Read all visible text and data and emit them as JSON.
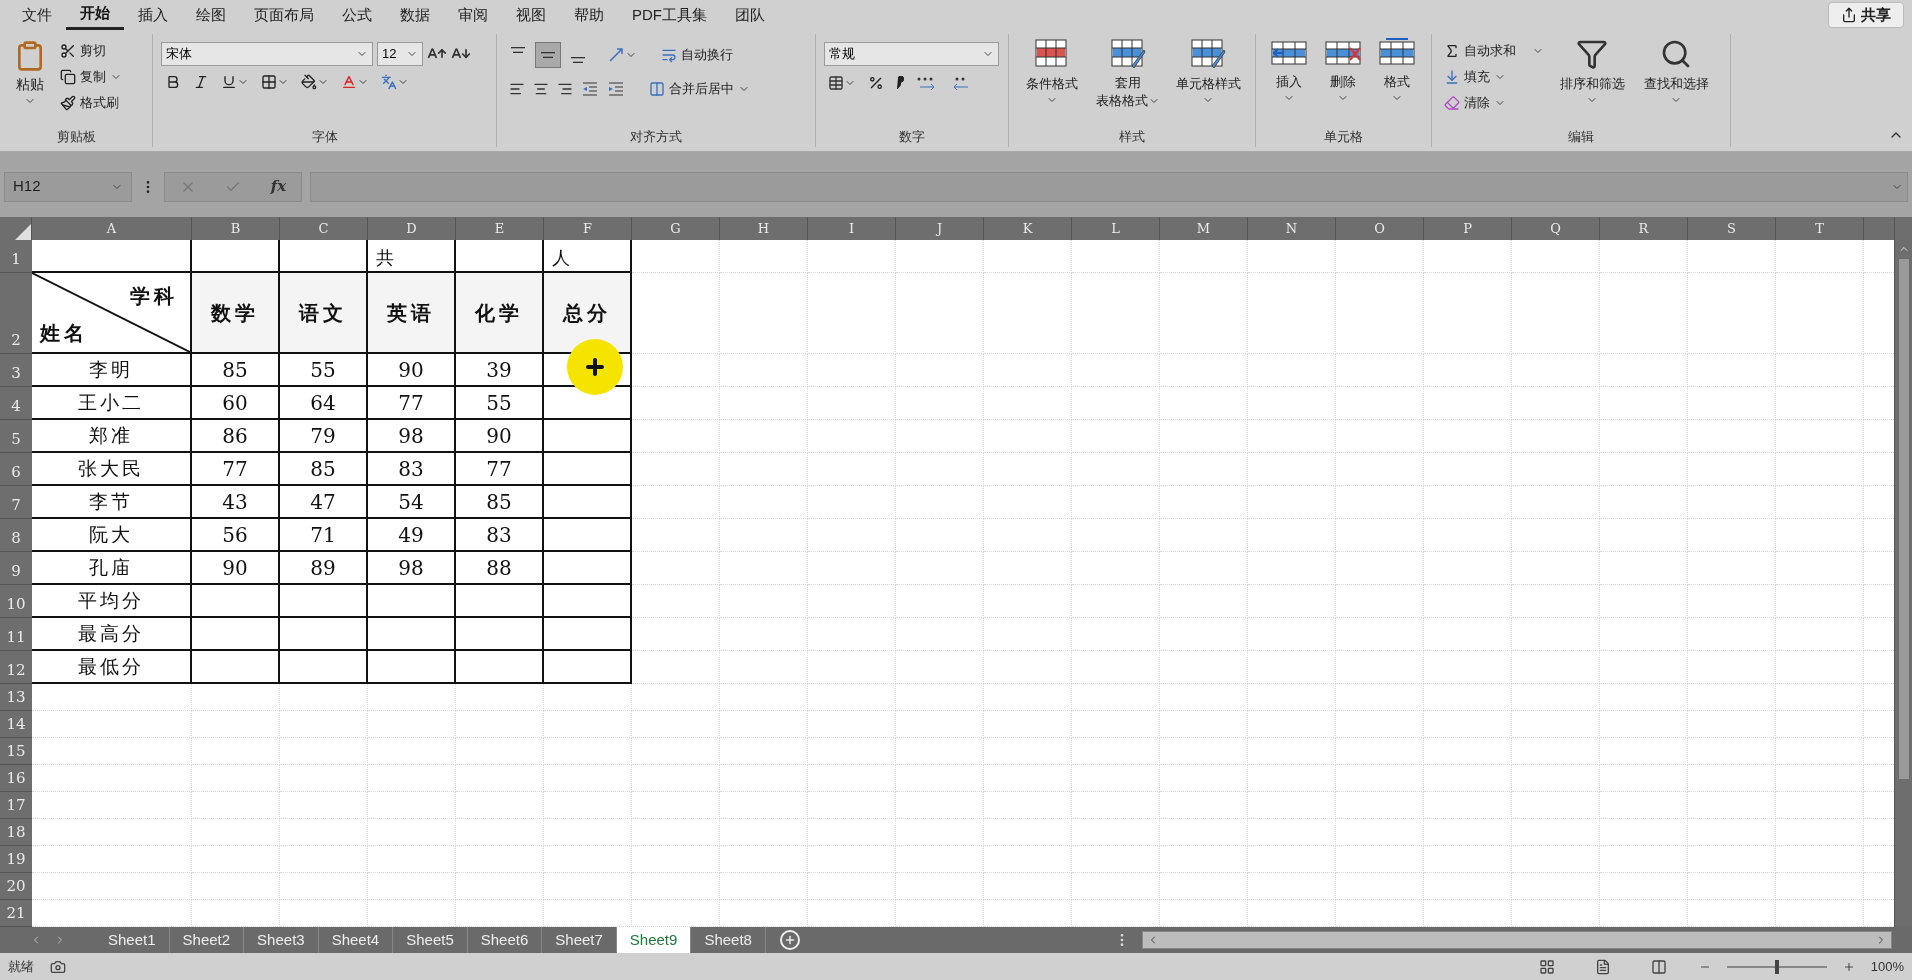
{
  "menu": {
    "tabs": [
      {
        "label": "文件",
        "selected": false
      },
      {
        "label": "开始",
        "selected": true
      },
      {
        "label": "插入",
        "selected": false
      },
      {
        "label": "绘图",
        "selected": false
      },
      {
        "label": "页面布局",
        "selected": false
      },
      {
        "label": "公式",
        "selected": false
      },
      {
        "label": "数据",
        "selected": false
      },
      {
        "label": "审阅",
        "selected": false
      },
      {
        "label": "视图",
        "selected": false
      },
      {
        "label": "帮助",
        "selected": false
      },
      {
        "label": "PDF工具集",
        "selected": false
      },
      {
        "label": "团队",
        "selected": false
      }
    ],
    "share": "共享"
  },
  "ribbon": {
    "clipboard": {
      "paste": "粘贴",
      "cut": "剪切",
      "copy": "复制",
      "format_painter": "格式刷",
      "label": "剪贴板"
    },
    "font": {
      "font_name": "宋体",
      "font_size": "12",
      "label": "字体"
    },
    "alignment": {
      "vertical": [
        {
          "kind": "top",
          "selected": false
        },
        {
          "kind": "middle",
          "selected": true
        },
        {
          "kind": "bottom",
          "selected": false
        }
      ],
      "wrap_text": "自动换行",
      "merge_center": "合并后居中",
      "label": "对齐方式"
    },
    "number": {
      "format": "常规",
      "label": "数字"
    },
    "styles": {
      "conditional": "条件格式",
      "table_format": [
        "套用",
        "表格格式"
      ],
      "cell_styles": "单元格样式",
      "label": "样式"
    },
    "cells": {
      "insert": "插入",
      "delete": "删除",
      "format": "格式",
      "label": "单元格"
    },
    "editing": {
      "autosum": "自动求和",
      "fill": "填充",
      "clear": "清除",
      "sort_filter": "排序和筛选",
      "find_select": "查找和选择",
      "label": "编辑"
    }
  },
  "formula_bar": {
    "name_box": "H12",
    "function_label": "fx"
  },
  "columns": [
    "A",
    "B",
    "C",
    "D",
    "E",
    "F",
    "G",
    "H",
    "I",
    "J",
    "K",
    "L",
    "M",
    "N",
    "O",
    "P",
    "Q",
    "R",
    "S",
    "T"
  ],
  "row_numbers": [
    "1",
    "2",
    "3",
    "4",
    "5",
    "6",
    "7",
    "8",
    "9",
    "10",
    "11",
    "12",
    "13",
    "14",
    "15",
    "16",
    "17",
    "18",
    "19",
    "20",
    "21"
  ],
  "table": {
    "row_1": {
      "column_D": "共",
      "column_F": "人"
    },
    "corner": {
      "top": "学科",
      "bottom": "姓名"
    },
    "subjects": [
      "数学",
      "语文",
      "英语",
      "化学",
      "总分"
    ],
    "students": [
      {
        "name": "李明",
        "scores": [
          "85",
          "55",
          "90",
          "39"
        ]
      },
      {
        "name": "王小二",
        "scores": [
          "60",
          "64",
          "77",
          "55"
        ]
      },
      {
        "name": "郑准",
        "scores": [
          "86",
          "79",
          "98",
          "90"
        ]
      },
      {
        "name": "张大民",
        "scores": [
          "77",
          "85",
          "83",
          "77"
        ]
      },
      {
        "name": "李节",
        "scores": [
          "43",
          "47",
          "54",
          "85"
        ]
      },
      {
        "name": "阮大",
        "scores": [
          "56",
          "71",
          "49",
          "83"
        ]
      },
      {
        "name": "孔庙",
        "scores": [
          "90",
          "89",
          "98",
          "88"
        ]
      }
    ],
    "summary_rows": [
      "平均分",
      "最高分",
      "最低分"
    ]
  },
  "sheet_tabs": [
    {
      "label": "Sheet1",
      "selected": false
    },
    {
      "label": "Sheet2",
      "selected": false
    },
    {
      "label": "Sheet3",
      "selected": false
    },
    {
      "label": "Sheet4",
      "selected": false
    },
    {
      "label": "Sheet5",
      "selected": false
    },
    {
      "label": "Sheet6",
      "selected": false
    },
    {
      "label": "Sheet7",
      "selected": false
    },
    {
      "label": "Sheet9",
      "selected": true
    },
    {
      "label": "Sheet8",
      "selected": false
    }
  ],
  "status_bar": {
    "status": "就绪",
    "zoom": {
      "level": 0.5,
      "reading": "100%"
    }
  }
}
